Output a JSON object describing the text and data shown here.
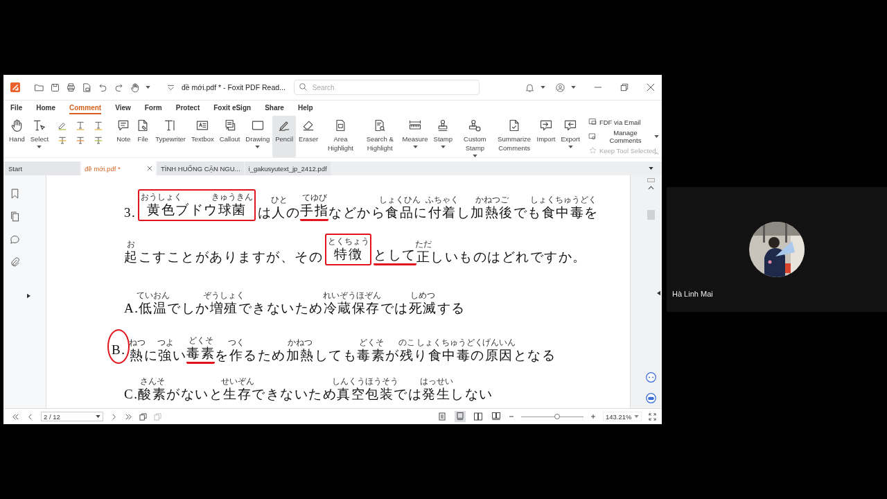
{
  "window": {
    "title": "đề mới.pdf * - Foxit PDF Read...",
    "search": {
      "placeholder": "Search"
    }
  },
  "menu": [
    {
      "label": "File",
      "selected": false
    },
    {
      "label": "Home",
      "selected": false
    },
    {
      "label": "Comment",
      "selected": true
    },
    {
      "label": "View",
      "selected": false
    },
    {
      "label": "Form",
      "selected": false
    },
    {
      "label": "Protect",
      "selected": false
    },
    {
      "label": "Foxit eSign",
      "selected": false
    },
    {
      "label": "Share",
      "selected": false
    },
    {
      "label": "Help",
      "selected": false
    }
  ],
  "tools": [
    {
      "label": "Hand",
      "dropdown": false,
      "selected": false
    },
    {
      "label": "Select",
      "dropdown": true,
      "selected": false
    },
    {
      "label": "Note",
      "dropdown": false,
      "selected": false
    },
    {
      "label": "File",
      "dropdown": false,
      "selected": false
    },
    {
      "label": "Typewriter",
      "dropdown": false,
      "selected": false
    },
    {
      "label": "Textbox",
      "dropdown": false,
      "selected": false
    },
    {
      "label": "Callout",
      "dropdown": false,
      "selected": false
    },
    {
      "label": "Drawing",
      "dropdown": true,
      "selected": false
    },
    {
      "label": "Pencil",
      "dropdown": false,
      "selected": true
    },
    {
      "label": "Eraser",
      "dropdown": false,
      "selected": false
    },
    {
      "label": "Area Highlight",
      "dropdown": false,
      "selected": false
    },
    {
      "label": "Search & Highlight",
      "dropdown": false,
      "selected": false
    },
    {
      "label": "Measure",
      "dropdown": true,
      "selected": false
    },
    {
      "label": "Stamp",
      "dropdown": true,
      "selected": false
    },
    {
      "label": "Custom Stamp",
      "dropdown": true,
      "selected": false
    },
    {
      "label": "Summarize Comments",
      "dropdown": false,
      "selected": false
    },
    {
      "label": "Import",
      "dropdown": false,
      "selected": false
    },
    {
      "label": "Export",
      "dropdown": true,
      "selected": false
    }
  ],
  "side_commands": [
    {
      "label": "FDF via Email",
      "dropdown": false,
      "disabled": false
    },
    {
      "label": "Manage Comments",
      "dropdown": true,
      "disabled": false
    },
    {
      "label": "Keep Tool Selected",
      "dropdown": false,
      "disabled": true
    }
  ],
  "doc_tabs": [
    {
      "label": "Start",
      "selected": false
    },
    {
      "label": "đề mới.pdf *",
      "selected": true
    },
    {
      "label": "TÌNH HUỐNG CẬN NGU...",
      "selected": false
    },
    {
      "label": "i_gakusyutext_jp_2412.pdf",
      "selected": false
    }
  ],
  "document": {
    "question": [
      [
        {
          "text": "3."
        },
        {
          "boxed": true,
          "parts": [
            {
              "text": "黄色",
              "ruby": "おうしょく"
            },
            {
              "text": "ブドウ"
            },
            {
              "text": "球菌",
              "ruby": "きゅうきん"
            }
          ]
        },
        {
          "text": "は"
        },
        {
          "text": "人",
          "ruby": "ひと"
        },
        {
          "text": "の"
        },
        {
          "text": "手指",
          "ruby": "てゆび",
          "underlined": true
        },
        {
          "text": "などから"
        },
        {
          "text": "食品",
          "ruby": "しょくひん"
        },
        {
          "text": "に"
        },
        {
          "text": "付着",
          "ruby": "ふちゃく"
        },
        {
          "text": "し"
        },
        {
          "text": "加熱後",
          "ruby": "かねつご"
        },
        {
          "text": "でも"
        },
        {
          "text": "食中毒",
          "ruby": "しょくちゅうどく"
        },
        {
          "text": "を"
        }
      ],
      [
        {
          "text": "起",
          "ruby": "お"
        },
        {
          "text": "こすことがありますが、その"
        },
        {
          "text": "特徴",
          "ruby": "とくちょう",
          "boxed": true
        },
        {
          "text": "として",
          "underlined": true
        },
        {
          "text": "正",
          "ruby": "ただ"
        },
        {
          "text": "しいものはどれですか。"
        }
      ]
    ],
    "options": [
      [
        {
          "text": "A."
        },
        {
          "text": "低温",
          "ruby": "ていおん"
        },
        {
          "text": "でしか"
        },
        {
          "text": "増殖",
          "ruby": "ぞうしょく"
        },
        {
          "text": "できないため"
        },
        {
          "text": "冷蔵保存",
          "ruby": "れいぞうほぞん"
        },
        {
          "text": "では"
        },
        {
          "text": "死滅",
          "ruby": "しめつ"
        },
        {
          "text": "する"
        }
      ],
      [
        {
          "text": "B.",
          "circled": true
        },
        {
          "text": "熱",
          "ruby": "ねつ"
        },
        {
          "text": "に"
        },
        {
          "text": "強",
          "ruby": "つよ"
        },
        {
          "text": "い"
        },
        {
          "text": "毒素",
          "ruby": "どくそ",
          "underlined": true
        },
        {
          "text": "を"
        },
        {
          "text": "作",
          "ruby": "つく"
        },
        {
          "text": "るため"
        },
        {
          "text": "加熱",
          "ruby": "かねつ"
        },
        {
          "text": "しても"
        },
        {
          "text": "毒素",
          "ruby": "どくそ"
        },
        {
          "text": "が"
        },
        {
          "text": "残",
          "ruby": "のこ"
        },
        {
          "text": "り"
        },
        {
          "text": "食中毒",
          "ruby": "しょくちゅうどく"
        },
        {
          "text": "の"
        },
        {
          "text": "原因",
          "ruby": "げんいん"
        },
        {
          "text": "となる"
        }
      ],
      [
        {
          "text": "C."
        },
        {
          "text": "酸素",
          "ruby": "さんそ"
        },
        {
          "text": "がないと"
        },
        {
          "text": "生存",
          "ruby": "せいぞん"
        },
        {
          "text": "できないため"
        },
        {
          "text": "真空包装",
          "ruby": "しんくうほうそう"
        },
        {
          "text": "では"
        },
        {
          "text": "発生",
          "ruby": "はっせい"
        },
        {
          "text": "しない"
        }
      ]
    ]
  },
  "status_bar": {
    "page": "2 / 12",
    "zoom": "143.21%",
    "zoom_slider": {
      "level": 0.58
    }
  },
  "participant": {
    "name": "Hà Linh Mai"
  }
}
